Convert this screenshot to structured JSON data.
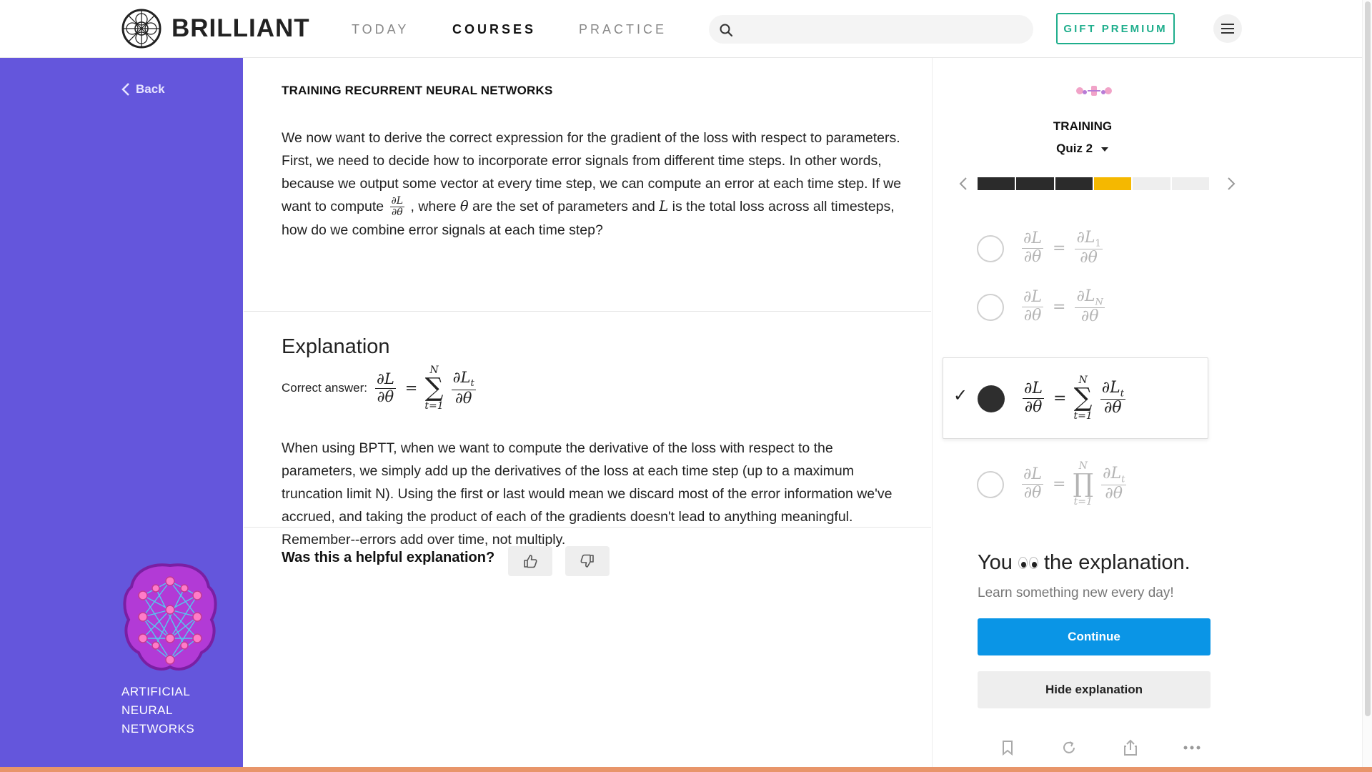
{
  "header": {
    "brand": "BRILLIANT",
    "nav": [
      {
        "label": "TODAY",
        "active": false
      },
      {
        "label": "COURSES",
        "active": true
      },
      {
        "label": "PRACTICE",
        "active": false
      }
    ],
    "search": {
      "placeholder": "",
      "value": ""
    },
    "gift_label": "GIFT PREMIUM"
  },
  "sidebar": {
    "back_label": "Back",
    "course_title": "ARTIFICIAL NEURAL NETWORKS",
    "accent": "#6456dc"
  },
  "main": {
    "topic": "TRAINING RECURRENT NEURAL NETWORKS",
    "problem": {
      "part1": "We now want to derive the correct expression for the gradient of the loss with respect to parameters. First, we need to decide how to incorporate error signals from different time steps. In other words, because we output some vector at every time step, we can compute an error at each time step. If we want to compute",
      "frac_num": "∂L",
      "frac_den": "∂θ",
      "part2": ", where",
      "theta": "θ",
      "part3": "are the set of parameters and",
      "L": "L",
      "part4": "is the total loss across all timesteps, how do we combine error signals at each time step?"
    },
    "explanation_heading": "Explanation",
    "correct_answer_label": "Correct answer:",
    "explanation_body": "When using BPTT, when we want to compute the derivative of the loss with respect to the parameters, we simply add up the derivatives of the loss at each time step (up to a maximum truncation limit N). Using the first or last would mean we discard most of the error information we've accrued, and taking the product of each of the gradients doesn't lead to anything meaningful. Remember--errors add over time, not multiply.",
    "helpful_question": "Was this a helpful explanation?"
  },
  "math": {
    "dL": "∂L",
    "dtheta": "∂θ",
    "dL1": "∂L",
    "sub1": "1",
    "dLN": "∂L",
    "subN": "N",
    "dLt": "∂L",
    "subt": "t",
    "eq": "=",
    "sum": "∑",
    "prod": "∏",
    "upper": "N",
    "lower": "t=1"
  },
  "quiz": {
    "chapter": "TRAINING",
    "quiz_label": "Quiz 2",
    "progress": [
      "done",
      "done",
      "done",
      "current",
      "todo",
      "todo"
    ],
    "colors": {
      "done": "#2b2b2b",
      "current": "#f5b800",
      "todo": "#eeeeee"
    },
    "selected_option": 3,
    "check_mark": "✓",
    "result_prefix": "You",
    "result_suffix": "the explanation.",
    "subtext": "Learn something new every day!",
    "continue_label": "Continue",
    "hide_label": "Hide explanation",
    "toolbar_icons": [
      "bookmark-icon",
      "refresh-icon",
      "share-icon",
      "more-icon"
    ]
  }
}
